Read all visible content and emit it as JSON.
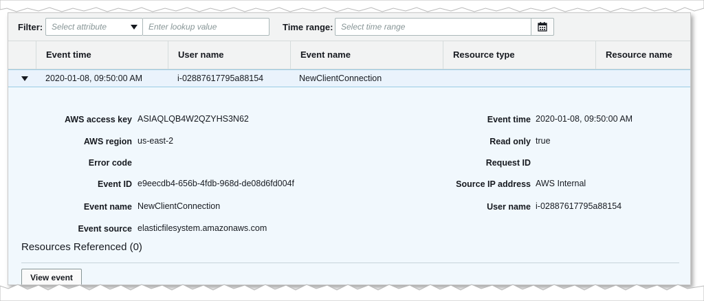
{
  "filter": {
    "label": "Filter:",
    "attribute_placeholder": "Select attribute",
    "lookup_placeholder": "Enter lookup value",
    "time_label": "Time range:",
    "time_placeholder": "Select time range"
  },
  "table": {
    "columns": [
      "Event time",
      "User name",
      "Event name",
      "Resource type",
      "Resource name"
    ],
    "row": {
      "event_time": "2020-01-08, 09:50:00 AM",
      "user_name": "i-02887617795a88154",
      "event_name": "NewClientConnection"
    }
  },
  "details": {
    "left": [
      {
        "key": "AWS access key",
        "value": "ASIAQLQB4W2QZYHS3N62"
      },
      {
        "key": "AWS region",
        "value": "us-east-2"
      },
      {
        "key": "Error code",
        "value": ""
      },
      {
        "key": "Event ID",
        "value": "e9eecdb4-656b-4fdb-968d-de08d6fd004f"
      },
      {
        "key": "Event name",
        "value": "NewClientConnection"
      },
      {
        "key": "Event source",
        "value": "elasticfilesystem.amazonaws.com"
      }
    ],
    "right": [
      {
        "key": "Event time",
        "value": "2020-01-08, 09:50:00 AM"
      },
      {
        "key": "Read only",
        "value": "true"
      },
      {
        "key": "Request ID",
        "value": ""
      },
      {
        "key": "Source IP address",
        "value": "AWS Internal"
      },
      {
        "key": "User name",
        "value": "i-02887617795a88154"
      }
    ]
  },
  "resources": {
    "title": "Resources Referenced (0)",
    "button": "View event"
  },
  "icons": {
    "dropdown": "caret-down-icon",
    "calendar": "calendar-icon",
    "expand": "expanded-triangle-icon"
  }
}
